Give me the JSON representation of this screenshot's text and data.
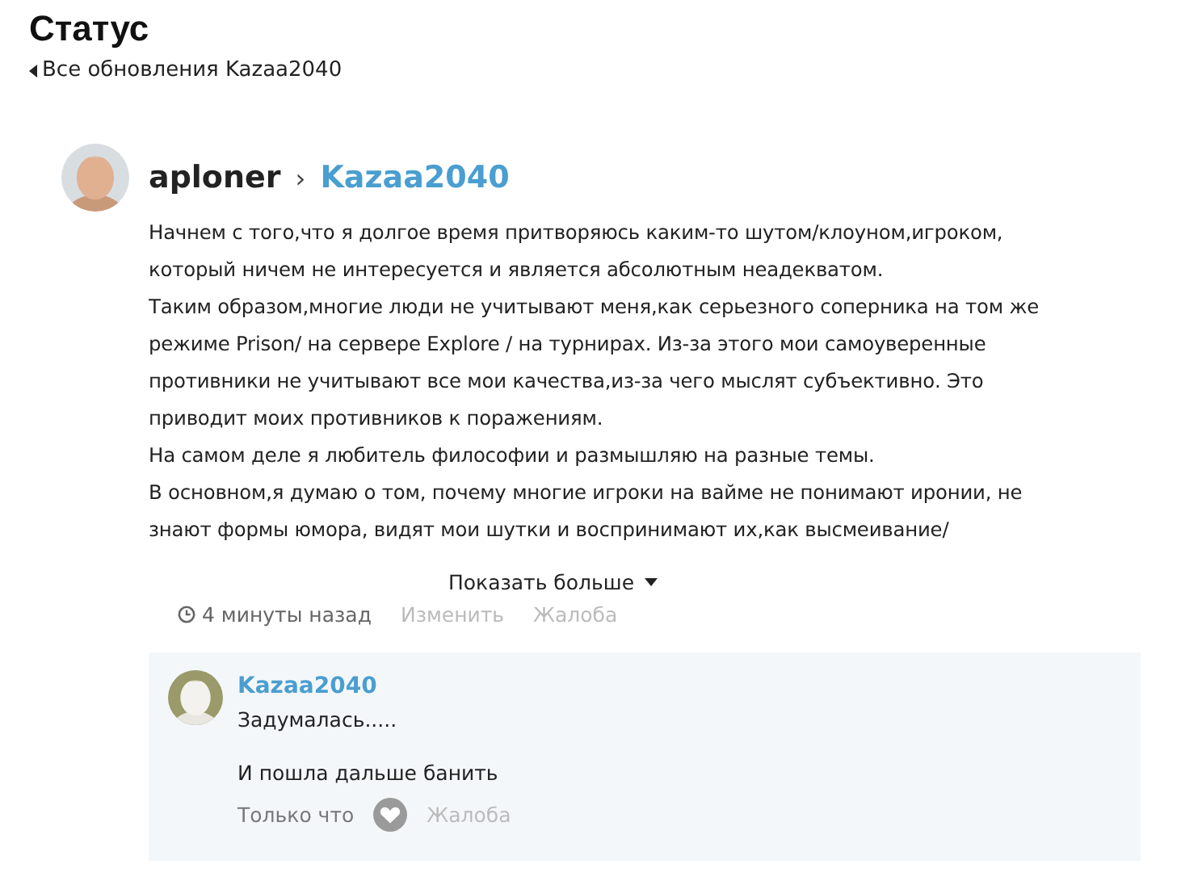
{
  "page": {
    "title": "Статус",
    "back_link": "Все обновления Kazaa2040"
  },
  "post": {
    "author": "aploner",
    "separator": "›",
    "target": "Kazaa2040",
    "body_lines": [
      "Начнем с того,что я долгое время притворяюсь каким-то шутом/клоуном,игроком,",
      "который ничем не интересуется и является абсолютным неадекватом.",
      "Таким образом,многие люди не учитывают меня,как серьезного соперника на том же",
      "режиме Prison/ на сервере Explore / на турнирах. Из-за этого мои самоуверенные",
      "противники не учитывают все мои качества,из-за чего мыслят субъективно. Это",
      "приводит моих противников к поражениям.",
      "На самом деле я любитель философии и размышляю на разные темы.",
      "В основном,я думаю о том, почему многие игроки на вайме не понимают иронии, не",
      "знают формы юмора, видят мои шутки и воспринимают их,как высмеивание/"
    ],
    "show_more": "Показать больше",
    "time": "4 минуты назад",
    "actions": [
      "Изменить",
      "Жалоба"
    ]
  },
  "comment": {
    "author": "Kazaa2040",
    "lines": [
      "Задумалась.....",
      "И пошла дальше банить"
    ],
    "time": "Только что",
    "report": "Жалоба"
  }
}
